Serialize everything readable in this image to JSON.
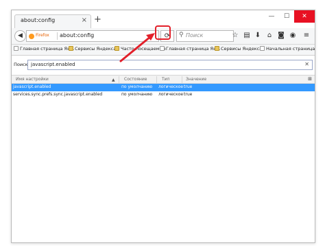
{
  "window": {
    "minimize_glyph": "—",
    "maximize_glyph": "☐",
    "close_glyph": "✕"
  },
  "tab": {
    "title": "about:config",
    "close_glyph": "×"
  },
  "new_tab_glyph": "+",
  "navbar": {
    "back_glyph": "◀",
    "browser_label": "Firefox",
    "url": "about:config",
    "reload_glyph": "⟳",
    "search_placeholder": "Поиск",
    "toolbar_icons": [
      "star-icon",
      "reading-list-icon",
      "download-icon",
      "home-icon",
      "pocket-icon",
      "sync-icon",
      "menu-icon"
    ]
  },
  "bookmarks": [
    {
      "label": "Главная страница Ян...",
      "icon": "page"
    },
    {
      "label": "Сервисы Яндекса",
      "icon": "folder"
    },
    {
      "label": "Часто посещаемые",
      "icon": "folder"
    },
    {
      "label": "Главная страница Ян...",
      "icon": "page"
    },
    {
      "label": "Сервисы Яндекса",
      "icon": "folder"
    },
    {
      "label": "Начальная страница",
      "icon": "page"
    }
  ],
  "filter": {
    "label": "Поиск:",
    "value": "javascript.enabled",
    "clear_glyph": "✕"
  },
  "table": {
    "headers": {
      "name": "Имя настройки",
      "status": "Состояние",
      "type": "Тип",
      "value": "Значение"
    },
    "rows": [
      {
        "name": "javascript.enabled",
        "status": "по умолчанию",
        "type": "логическое",
        "value": "true",
        "selected": true
      },
      {
        "name": "services.sync.prefs.sync.javascript.enabled",
        "status": "по умолчанию",
        "type": "логическое",
        "value": "true",
        "selected": false
      }
    ]
  },
  "colors": {
    "selection": "#3399ff",
    "annotation": "#e2202a",
    "close_button": "#e81123"
  }
}
